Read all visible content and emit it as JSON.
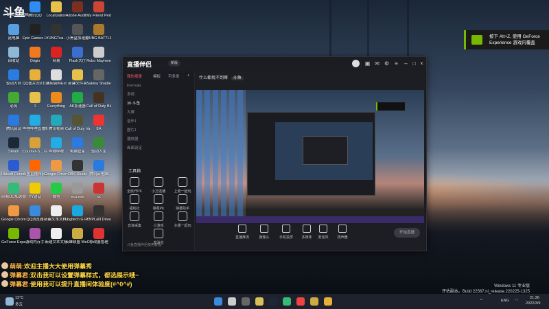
{
  "brand": {
    "logo": "斗鱼",
    "sub": "DOUYU.COM"
  },
  "desktop_icons": [
    {
      "label": "腾讯QQ",
      "color": "#2f8cf0"
    },
    {
      "label": "Localization",
      "color": "#e8c14a"
    },
    {
      "label": "Adobe Audit...",
      "color": "#7a2f1f"
    },
    {
      "label": "My Friend Pedro",
      "color": "#c43"
    },
    {
      "label": "此电脑",
      "color": "#5aa0e0"
    },
    {
      "label": "Epic Games Launcher",
      "color": "#222"
    },
    {
      "label": "YUNGTrai...",
      "color": "#333"
    },
    {
      "label": "小黑盒加速器",
      "color": "#555"
    },
    {
      "label": "PUBG BATTLEGR...",
      "color": "#aa7a2a"
    },
    {
      "label": "回收站",
      "color": "#8fb7d6"
    },
    {
      "label": "Origin",
      "color": "#f07820"
    },
    {
      "label": "网易",
      "color": "#d22"
    },
    {
      "label": "Flash大厅",
      "color": "#3a6fd0"
    },
    {
      "label": "Robo Mayhem",
      "color": "#ccc"
    },
    {
      "label": "驱动大师",
      "color": "#2b7ce0"
    },
    {
      "label": "QQ图片20210225...",
      "color": "#e8b03a"
    },
    {
      "label": "通用资料Ext",
      "color": "#ddd"
    },
    {
      "label": "新建文件夹",
      "color": "#e8c14a"
    },
    {
      "label": "Sakina Shadie",
      "color": "#666"
    },
    {
      "label": "必剪",
      "color": "#4a3"
    },
    {
      "label": "1",
      "color": "#e8c14a"
    },
    {
      "label": "Everything",
      "color": "#f08a1a"
    },
    {
      "label": "AK加速器",
      "color": "#2a4"
    },
    {
      "label": "Call of Duty Black Op...",
      "color": "#432"
    },
    {
      "label": "腾讯会议",
      "color": "#2a7ae0"
    },
    {
      "label": "哔哩哔哩直播姬",
      "color": "#23ade5"
    },
    {
      "label": "腾讯视频",
      "color": "#2ab"
    },
    {
      "label": "Call of Duty Vanguard",
      "color": "#553"
    },
    {
      "label": "EA",
      "color": "#e33"
    },
    {
      "label": "Steam",
      "color": "#1b2838"
    },
    {
      "label": "Counter-S... Global Off...",
      "color": "#d8a23a"
    },
    {
      "label": "哔哩哔哩",
      "color": "#23ade5"
    },
    {
      "label": "电脑管家",
      "color": "#2a7ae0"
    },
    {
      "label": "驱动人生",
      "color": "#3a8a3a"
    },
    {
      "label": "Ubisoft Connect",
      "color": "#2a5bd0"
    },
    {
      "label": "斗鱼直播伴侣工具",
      "color": "#f60"
    },
    {
      "label": "Google Chrome",
      "color": "#e94"
    },
    {
      "label": "OBS Studio",
      "color": "#333"
    },
    {
      "label": "腾讯云电脑",
      "color": "#2a7ae0"
    },
    {
      "label": "网易UU加速器",
      "color": "#3b7"
    },
    {
      "label": "YY语音",
      "color": "#ec0"
    },
    {
      "label": "微信",
      "color": "#2c4"
    },
    {
      "label": "ecu.exe",
      "color": "#999"
    },
    {
      "label": "xx",
      "color": "#c33"
    },
    {
      "label": "Google Chrome",
      "color": "#e94"
    },
    {
      "label": "QQ浏览器",
      "color": "#3a8ae0"
    },
    {
      "label": "新建文本文档1.txt",
      "color": "#eee"
    },
    {
      "label": "Logitech G HUB",
      "color": "#1aa8e0"
    },
    {
      "label": "YYPLaN Driver",
      "color": "#333"
    },
    {
      "label": "GeForce Experience",
      "color": "#76b900"
    },
    {
      "label": "游戏内存手",
      "color": "#a5a"
    },
    {
      "label": "新建文本文档",
      "color": "#eee"
    },
    {
      "label": "英雄联盟 WeGame版",
      "color": "#ca4"
    },
    {
      "label": "修改器管理",
      "color": "#d33"
    }
  ],
  "notification": {
    "text": "按下 Alt+Z, 使用 GeForce Experience 游戏内覆盖"
  },
  "app": {
    "name": "直播伴侣",
    "version": "新版",
    "tabs": [
      "我的场景",
      "模板",
      "可多发"
    ],
    "scenes": [
      "Formula",
      "多视",
      "38·斗鱼",
      "大屏",
      "音乐1",
      "图片1",
      "播放器",
      "画面设定"
    ],
    "tools_title": "工具箱",
    "tools": [
      {
        "label": "全民开PK"
      },
      {
        "label": "小万连播"
      },
      {
        "label": "上麦一起玩"
      },
      {
        "label": "福利社"
      },
      {
        "label": "弹幕PK"
      },
      {
        "label": "弹幕助手"
      },
      {
        "label": "音浪采集"
      },
      {
        "label": "小游戏"
      },
      {
        "label": "主播一起玩"
      },
      {
        "label": "发消息"
      }
    ],
    "main_title": "什么都找不到嘛",
    "main_tag": "斗鱼",
    "controls": [
      {
        "label": "直播推流"
      },
      {
        "label": "摄像头"
      },
      {
        "label": "手机投屏"
      },
      {
        "label": "多媒体"
      },
      {
        "label": "麦克风"
      },
      {
        "label": "扬声器"
      }
    ],
    "start_label": "开始直播",
    "status": "斗鱼直播伴侣使用教程"
  },
  "chat": [
    {
      "user": "萌萌:",
      "text": "欢迎主播大大使用弹幕秀"
    },
    {
      "user": "弹幕君:",
      "text": "双击我可以设置弹幕样式，都选展示哦~"
    },
    {
      "user": "弹幕君:",
      "text": "使用我可以提升直播间体验度(#^0^#)"
    }
  ],
  "watermark": {
    "line1": "Windows 11 专业版",
    "line2": "评估副本。Build 22567.ni_release.220225-1325"
  },
  "taskbar": {
    "weather": "12°C",
    "weather_desc": "多云",
    "ime": "ENG",
    "time": "21:36",
    "date": "2022/3/9"
  }
}
